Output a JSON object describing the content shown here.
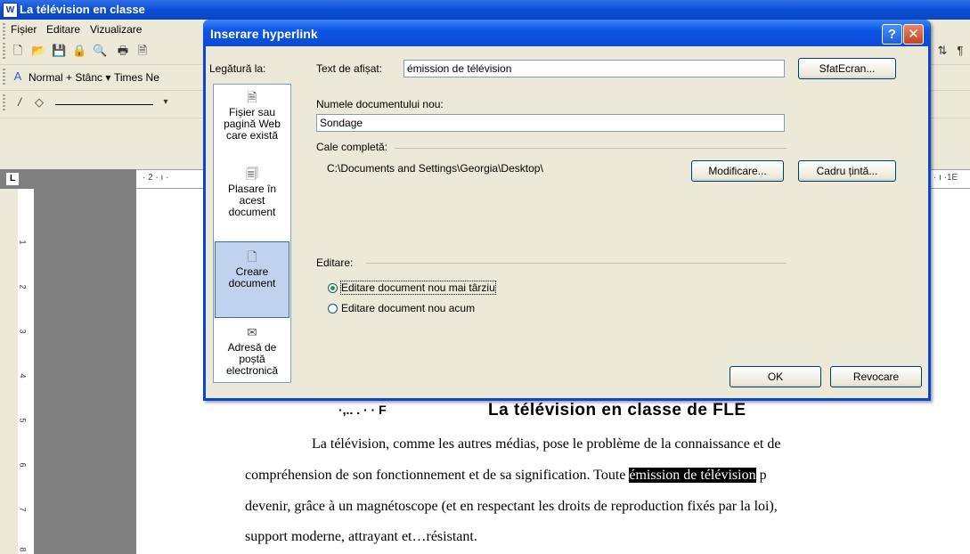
{
  "word": {
    "app_title": "La télévision en classe",
    "menu": [
      "Fișier",
      "Editare",
      "Vizualizare"
    ],
    "style_combo": "Normal + Stânc",
    "font_combo": "Times Ne",
    "ruler_corner": "L",
    "hruler_left": "· 2 · ı ·",
    "hruler_right": "· ı ·1E",
    "vruler_numbers": [
      "1",
      "2",
      "3",
      "4",
      "5",
      "6",
      "7",
      "8"
    ]
  },
  "document": {
    "heading": "La télévision en classe de FLE",
    "paragraph": {
      "line1": "La télévision, comme les autres médias, pose le problème de la connaissance et de",
      "line2_before": "compréhension de son fonctionnement et de  sa  signification. Toute ",
      "line2_highlight": "émission de télévision",
      "line2_after": " p",
      "line3": "devenir, grâce à un magnétoscope (et en respectant les droits de reproduction fixés par la loi),",
      "line4": "support moderne, attrayant et…résistant."
    }
  },
  "dialog": {
    "title": "Inserare hyperlink",
    "help_label": "?",
    "close_label": "✕",
    "link_to_label": "Legătură la:",
    "link_options": [
      {
        "label": "Fișier sau pagină Web care există",
        "icon": "web-page-icon"
      },
      {
        "label": "Plasare în acest document",
        "icon": "place-in-document-icon"
      },
      {
        "label": "Creare document",
        "icon": "new-document-icon"
      },
      {
        "label": "Adresă de poștă electronică",
        "icon": "email-icon"
      }
    ],
    "text_to_display_label": "Text de afișat:",
    "text_to_display_value": "émission de télévision",
    "screentip_button": "SfatEcran...",
    "new_doc_name_label": "Numele documentului nou:",
    "new_doc_name_value": "Sondage",
    "full_path_label": "Cale completă:",
    "full_path_value": "C:\\Documents and Settings\\Georgia\\Desktop\\",
    "change_button": "Modificare...",
    "target_frame_button": "Cadru țintă...",
    "edit_label": "Editare:",
    "edit_options": [
      "Editare document nou mai târziu",
      "Editare document nou acum"
    ],
    "ok_button": "OK",
    "cancel_button": "Revocare"
  }
}
